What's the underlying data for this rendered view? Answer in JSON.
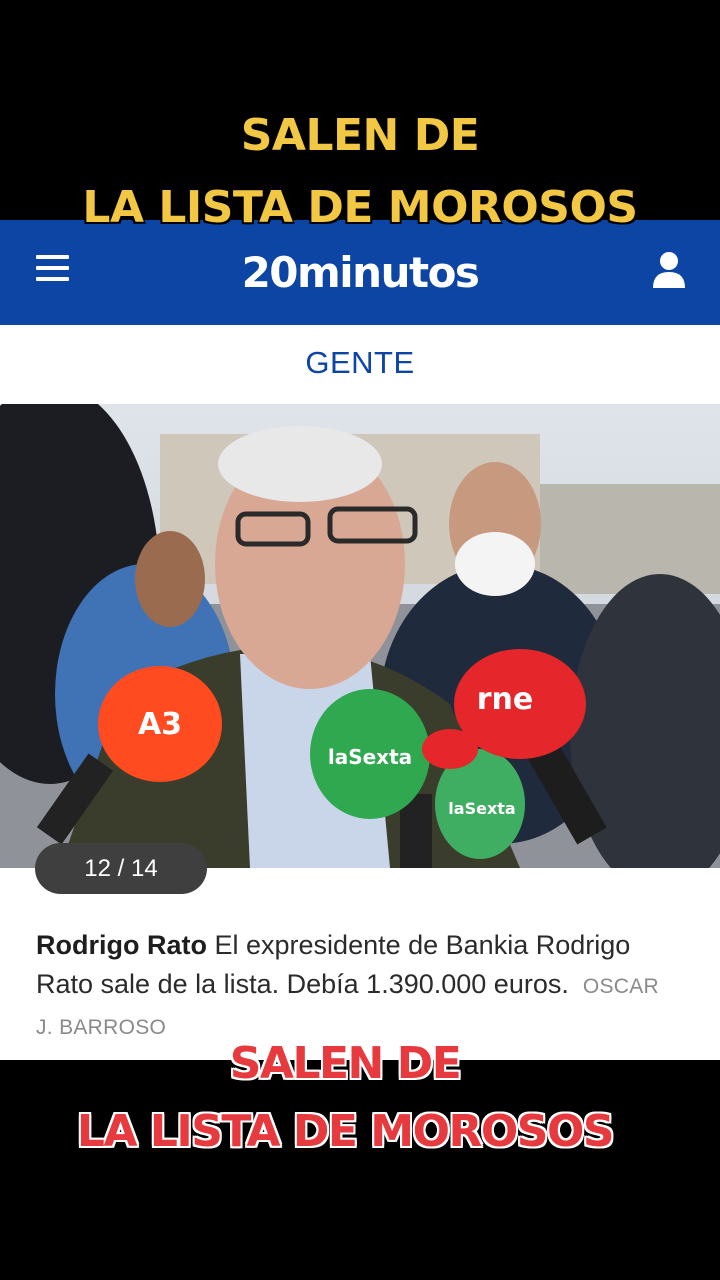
{
  "overlay": {
    "top_line1": "SALEN DE",
    "top_line2": "LA LISTA DE MOROSOS",
    "bottom_line1": "SALEN DE",
    "bottom_line2": "LA LISTA DE MOROSOS",
    "top_color": "#f2c744",
    "bottom_color": "#e63a3f"
  },
  "header": {
    "logo": "20minutos",
    "menu_icon": "hamburger-menu-icon",
    "user_icon": "user-icon",
    "brand_color": "#0d45a5"
  },
  "section": {
    "label": "GENTE"
  },
  "gallery": {
    "counter": "12 / 14",
    "photo_labels": {
      "mic_a3": "A3",
      "mic_sexta_1": "laSexta",
      "mic_sexta_2": "laSexta",
      "mic_rne": "rne"
    }
  },
  "article": {
    "name": "Rodrigo Rato",
    "text": "El expresidente de Bankia Rodrigo Rato sale de la lista. Debía 1.390.000 euros.",
    "credit": "OSCAR J. BARROSO"
  }
}
